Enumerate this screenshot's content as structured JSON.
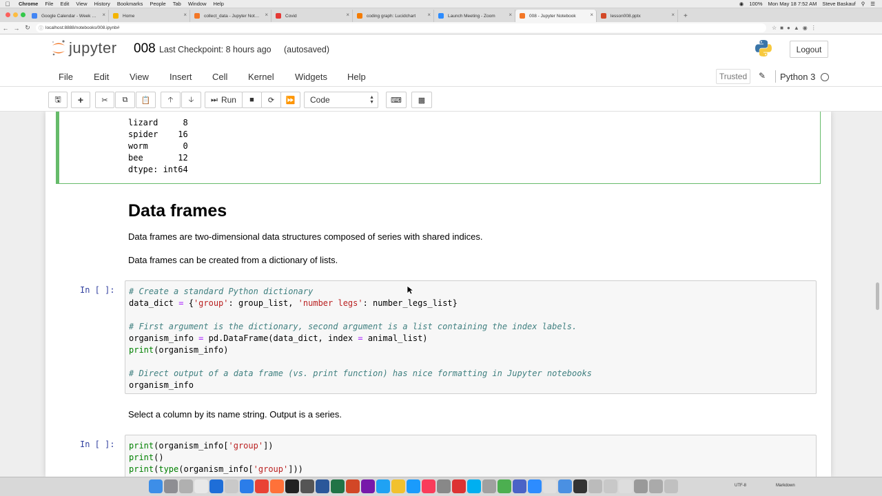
{
  "os_menubar": {
    "app": "Chrome",
    "items": [
      "File",
      "Edit",
      "View",
      "History",
      "Bookmarks",
      "People",
      "Tab",
      "Window",
      "Help"
    ],
    "battery": "100%",
    "clock": "Mon May 18  7:52 AM",
    "user": "Steve Baskauf"
  },
  "browser": {
    "tabs": [
      {
        "label": "Google Calendar - Week of M...",
        "color": "#4285f4"
      },
      {
        "label": "Home",
        "color": "#f4b400"
      },
      {
        "label": "collect_data - Jupyter Notebo...",
        "color": "#f37726"
      },
      {
        "label": "Covid",
        "color": "#e53935"
      },
      {
        "label": "coding graph: Lucidchart",
        "color": "#f57c00"
      },
      {
        "label": "Launch Meeting - Zoom",
        "color": "#2d8cff"
      },
      {
        "label": "008 - Jupyter Notebook",
        "color": "#f37726"
      },
      {
        "label": "lesson008.pptx",
        "color": "#d24726"
      }
    ],
    "active_tab_index": 6,
    "url": "localhost:8888/notebooks/008.ipynb#"
  },
  "jupyter": {
    "logo_text": "jupyter",
    "notebook_name": "008",
    "checkpoint": "Last Checkpoint: 8 hours ago",
    "autosave": "(autosaved)",
    "logout": "Logout",
    "menu": [
      "File",
      "Edit",
      "View",
      "Insert",
      "Cell",
      "Kernel",
      "Widgets",
      "Help"
    ],
    "trusted": "Trusted",
    "kernel": "Python 3",
    "run_label": "Run",
    "cell_type": "Code"
  },
  "cells": {
    "series_output": [
      "lizard     8",
      "spider    16",
      "worm       0",
      "bee       12",
      "dtype: int64"
    ],
    "heading": "Data frames",
    "para1": "Data frames are two-dimensional data structures composed of series with shared indices.",
    "para2": "Data frames can be created from a dictionary of lists.",
    "prompt1": "In [ ]:",
    "code1": {
      "l1_comment": "# Create a standard Python dictionary",
      "l2a": "data_dict ",
      "l2_eq": "=",
      "l2b": " {",
      "l2_s1": "'group'",
      "l2c": ": group_list, ",
      "l2_s2": "'number legs'",
      "l2d": ": number_legs_list}",
      "l4_comment": "# First argument is the dictionary, second argument is a list containing the index labels.",
      "l5a": "organism_info ",
      "l5_eq": "=",
      "l5b": " pd.DataFrame(data_dict, index ",
      "l5_eq2": "=",
      "l5c": " animal_list)",
      "l6_fn": "print",
      "l6b": "(organism_info)",
      "l8_comment": "# Direct output of a data frame (vs. print function) has nice formatting in Jupyter notebooks",
      "l9": "organism_info"
    },
    "para3": "Select a column by its name string. Output is a series.",
    "prompt2": "In [ ]:",
    "code2": {
      "l1_fn": "print",
      "l1b": "(organism_info[",
      "l1_s": "'group'",
      "l1c": "])",
      "l2_fn": "print",
      "l2b": "()",
      "l3_fn": "print",
      "l3b": "(",
      "l3_fn2": "type",
      "l3c": "(organism_info[",
      "l3_s": "'group'",
      "l3d": "]))"
    }
  },
  "dock": {
    "status": "UTF-8",
    "mode": "Markdown"
  },
  "colors": {
    "selected_border": "#66bb6a",
    "prompt": "#303f9f",
    "comment": "#408080",
    "string": "#ba2121",
    "jupyter_orange": "#f37726"
  }
}
